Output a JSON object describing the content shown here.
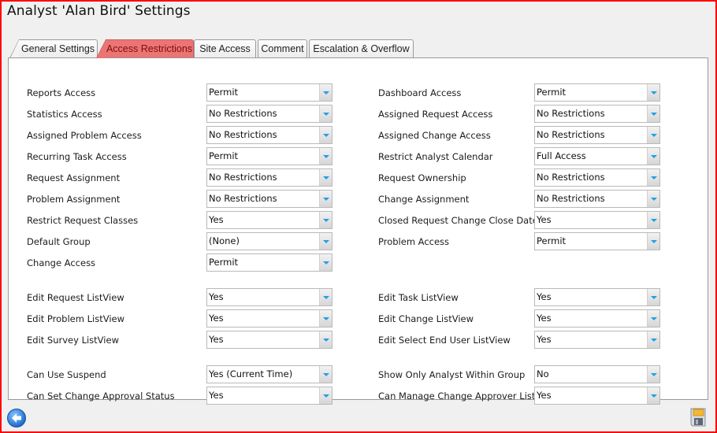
{
  "window": {
    "title": "Analyst 'Alan Bird' Settings"
  },
  "tabs": [
    {
      "label": "General Settings",
      "active": false
    },
    {
      "label": "Access Restrictions",
      "active": true
    },
    {
      "label": "Site Access",
      "active": false
    },
    {
      "label": "Comment",
      "active": false
    },
    {
      "label": "Escalation & Overflow",
      "active": false
    }
  ],
  "left_fields": [
    {
      "label": "Reports Access",
      "value": "Permit"
    },
    {
      "label": "Statistics Access",
      "value": "No Restrictions"
    },
    {
      "label": "Assigned Problem Access",
      "value": "No Restrictions"
    },
    {
      "label": "Recurring Task Access",
      "value": "Permit"
    },
    {
      "label": "Request Assignment",
      "value": "No Restrictions"
    },
    {
      "label": "Problem Assignment",
      "value": "No Restrictions"
    },
    {
      "label": "Restrict Request Classes",
      "value": "Yes"
    },
    {
      "label": "Default Group",
      "value": "(None)"
    },
    {
      "label": "Change Access",
      "value": "Permit"
    },
    {
      "label": "Edit Request ListView",
      "value": "Yes"
    },
    {
      "label": "Edit Problem ListView",
      "value": "Yes"
    },
    {
      "label": "Edit Survey ListView",
      "value": "Yes"
    },
    {
      "label": "Can Use Suspend",
      "value": "Yes (Current Time)"
    },
    {
      "label": "Can Set Change Approval Status",
      "value": "Yes"
    }
  ],
  "right_fields": [
    {
      "label": "Dashboard Access",
      "value": "Permit"
    },
    {
      "label": "Assigned Request Access",
      "value": "No Restrictions"
    },
    {
      "label": "Assigned Change Access",
      "value": "No Restrictions"
    },
    {
      "label": "Restrict Analyst Calendar",
      "value": "Full Access"
    },
    {
      "label": "Request Ownership",
      "value": "No Restrictions"
    },
    {
      "label": "Change Assignment",
      "value": "No Restrictions"
    },
    {
      "label": "Closed Request Change Close Date",
      "value": "Yes"
    },
    {
      "label": "Problem Access",
      "value": "Permit"
    },
    {
      "label": "Edit Task ListView",
      "value": "Yes"
    },
    {
      "label": "Edit Change ListView",
      "value": "Yes"
    },
    {
      "label": "Edit Select End User ListView",
      "value": "Yes"
    },
    {
      "label": "Show Only Analyst Within Group",
      "value": "No"
    },
    {
      "label": "Can Manage Change Approver List",
      "value": "Yes"
    }
  ],
  "footer": {
    "back_icon": "back-arrow-icon",
    "save_icon": "floppy-disk-icon"
  },
  "colors": {
    "active_tab": "#ed7474",
    "border": "#ff0000",
    "dropdown_arrow": "#1ea0e6"
  }
}
